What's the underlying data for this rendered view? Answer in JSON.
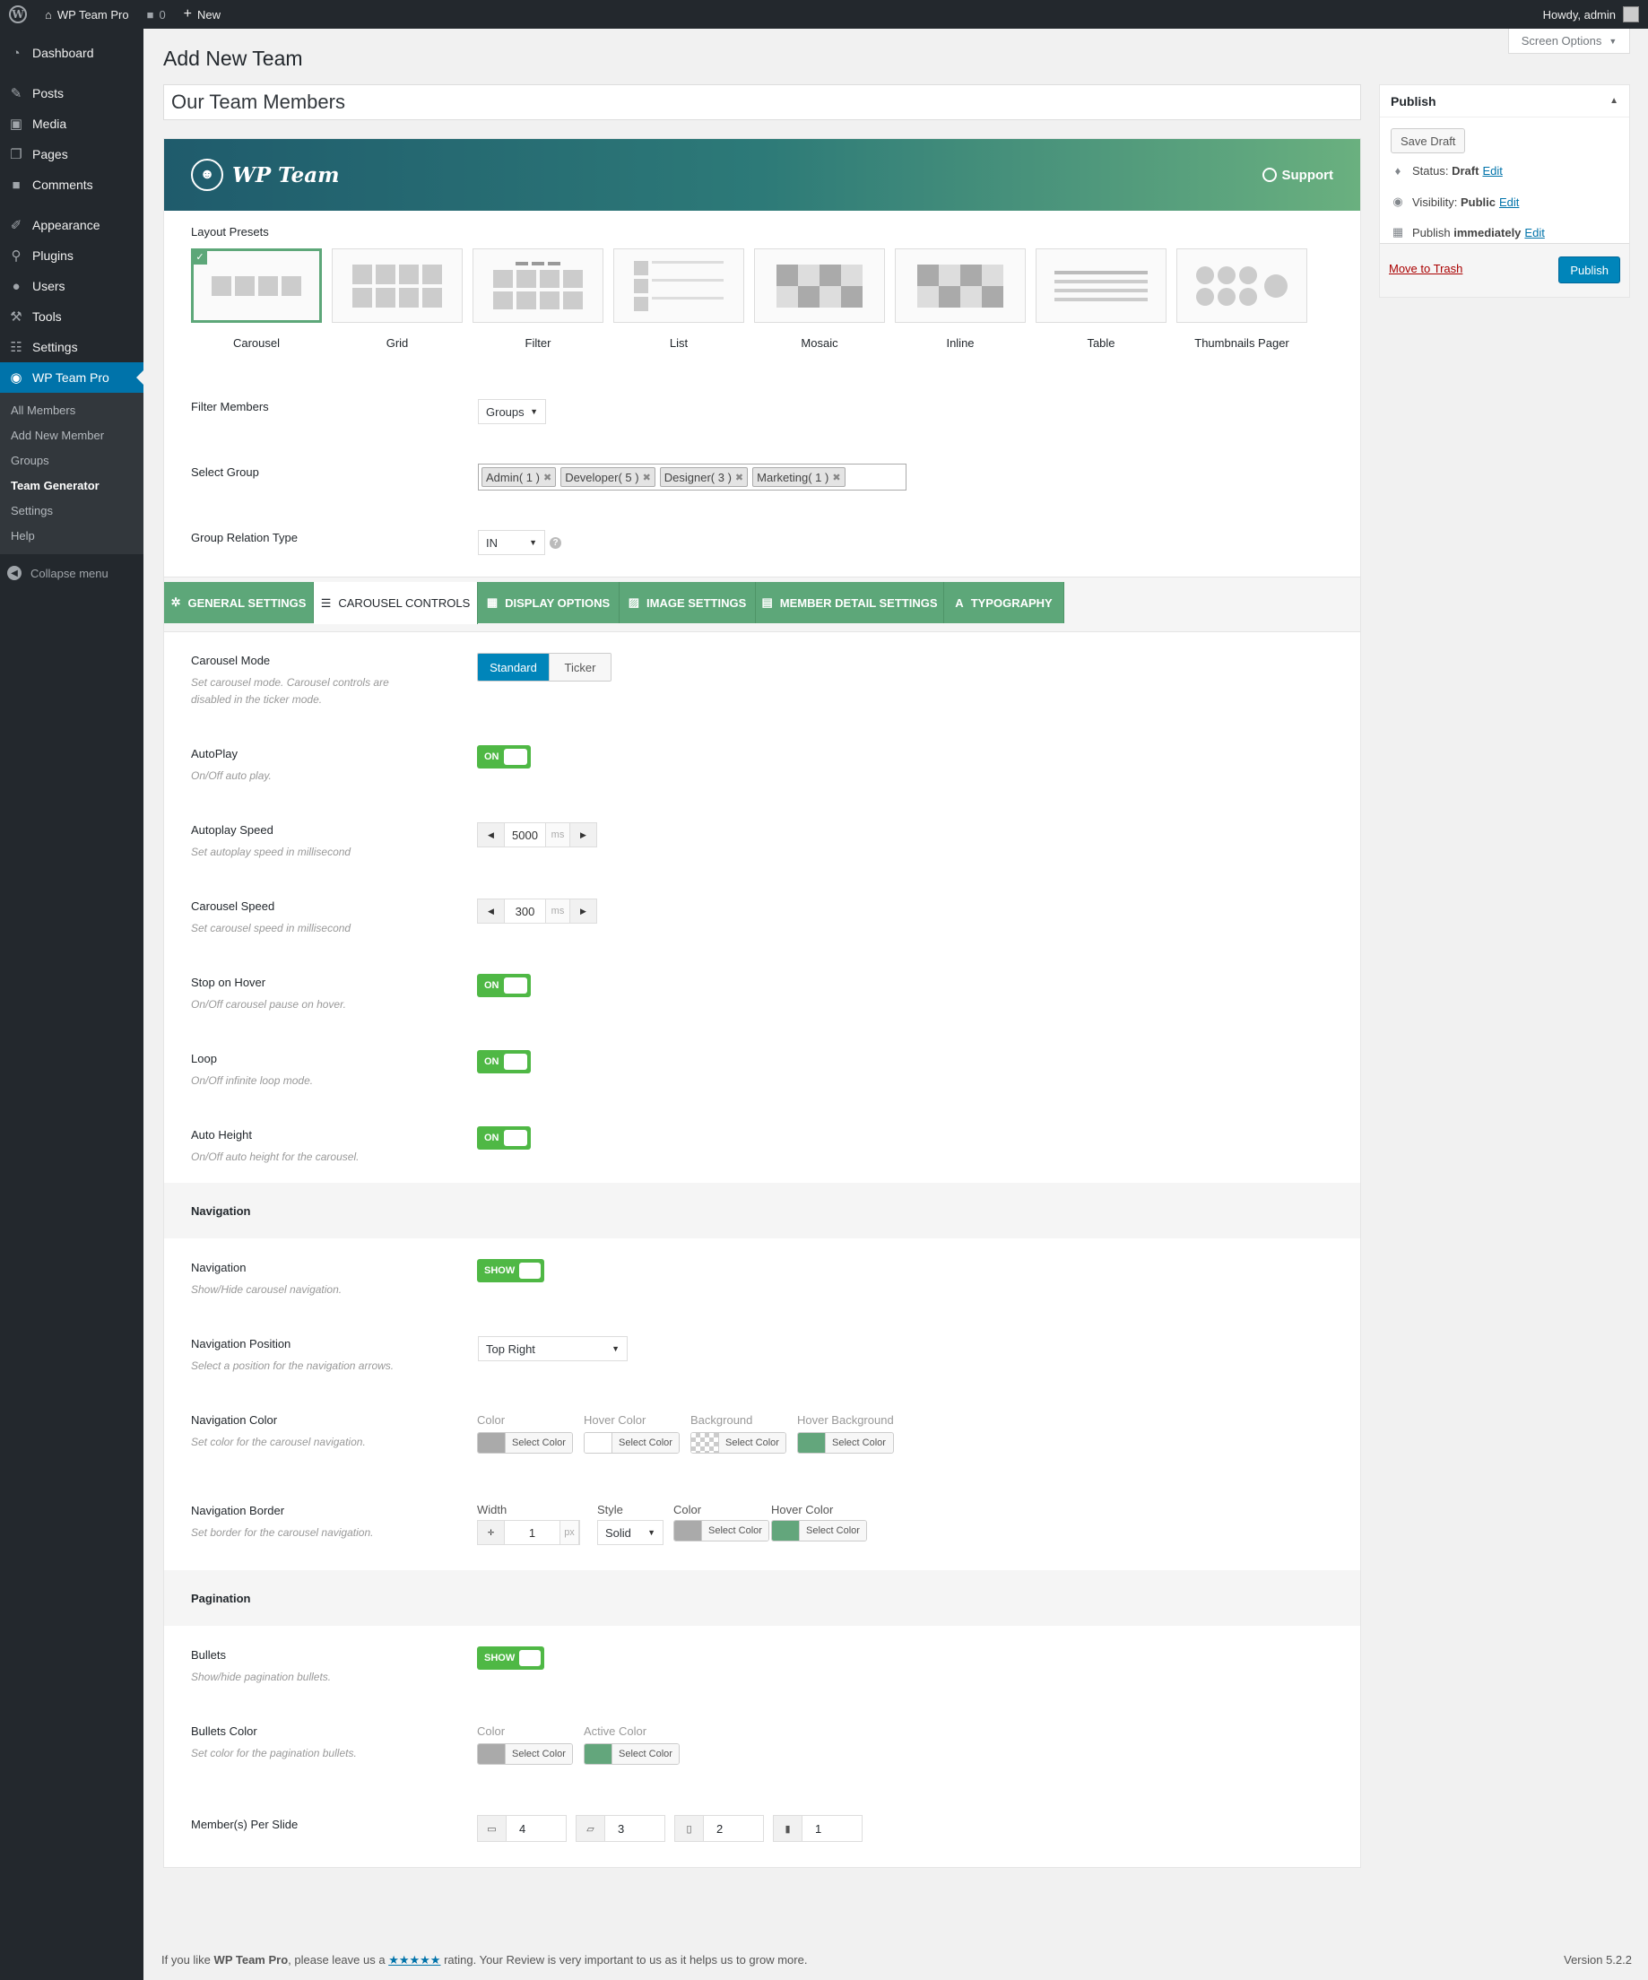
{
  "adminbar": {
    "site_name": "WP Team Pro",
    "comments_count": "0",
    "new_label": "New",
    "greeting": "Howdy, admin"
  },
  "sidebar": {
    "items": [
      {
        "label": "Dashboard",
        "icon": "dashboard-icon"
      },
      {
        "label": "Posts",
        "icon": "pin-icon"
      },
      {
        "label": "Media",
        "icon": "media-icon"
      },
      {
        "label": "Pages",
        "icon": "pages-icon"
      },
      {
        "label": "Comments",
        "icon": "comments-icon"
      },
      {
        "label": "Appearance",
        "icon": "brush-icon"
      },
      {
        "label": "Plugins",
        "icon": "plugin-icon"
      },
      {
        "label": "Users",
        "icon": "users-icon"
      },
      {
        "label": "Tools",
        "icon": "wrench-icon"
      },
      {
        "label": "Settings",
        "icon": "settings-icon"
      },
      {
        "label": "WP Team Pro",
        "icon": "team-icon"
      }
    ],
    "submenu": [
      "All Members",
      "Add New Member",
      "Groups",
      "Team Generator",
      "Settings",
      "Help"
    ],
    "collapse_label": "Collapse menu"
  },
  "screen_options": "Screen Options",
  "page_title": "Add New Team",
  "post_title": "Our Team Members",
  "banner": {
    "brand": "WP Team",
    "support": "Support"
  },
  "layout": {
    "label": "Layout Presets",
    "presets": [
      "Carousel",
      "Grid",
      "Filter",
      "List",
      "Mosaic",
      "Inline",
      "Table",
      "Thumbnails Pager"
    ],
    "selected": "Carousel"
  },
  "filter_members": {
    "label": "Filter Members",
    "value": "Groups"
  },
  "select_group": {
    "label": "Select Group",
    "tags": [
      "Admin( 1 )",
      "Developer( 5 )",
      "Designer( 3 )",
      "Marketing( 1 )"
    ]
  },
  "group_relation": {
    "label": "Group Relation Type",
    "value": "IN"
  },
  "tabs": [
    {
      "label": "GENERAL SETTINGS",
      "icon": "gear-icon"
    },
    {
      "label": "CAROUSEL CONTROLS",
      "icon": "sliders-icon"
    },
    {
      "label": "DISPLAY OPTIONS",
      "icon": "grid-icon"
    },
    {
      "label": "IMAGE SETTINGS",
      "icon": "image-icon"
    },
    {
      "label": "MEMBER DETAIL SETTINGS",
      "icon": "id-card-icon"
    },
    {
      "label": "TYPOGRAPHY",
      "icon": "font-icon"
    }
  ],
  "carousel": {
    "mode": {
      "label": "Carousel Mode",
      "desc": "Set carousel mode. Carousel controls are disabled in the ticker mode.",
      "options": [
        "Standard",
        "Ticker"
      ],
      "selected": "Standard"
    },
    "autoplay": {
      "label": "AutoPlay",
      "desc": "On/Off auto play.",
      "state": "ON"
    },
    "autoplay_speed": {
      "label": "Autoplay Speed",
      "desc": "Set autoplay speed in millisecond",
      "value": "5000",
      "unit": "ms"
    },
    "carousel_speed": {
      "label": "Carousel Speed",
      "desc": "Set carousel speed in millisecond",
      "value": "300",
      "unit": "ms"
    },
    "stop_hover": {
      "label": "Stop on Hover",
      "desc": "On/Off carousel pause on hover.",
      "state": "ON"
    },
    "loop": {
      "label": "Loop",
      "desc": "On/Off infinite loop mode.",
      "state": "ON"
    },
    "auto_height": {
      "label": "Auto Height",
      "desc": "On/Off auto height for the carousel.",
      "state": "ON"
    }
  },
  "navigation": {
    "heading": "Navigation",
    "nav": {
      "label": "Navigation",
      "desc": "Show/Hide carousel navigation.",
      "state": "SHOW"
    },
    "position": {
      "label": "Navigation Position",
      "desc": "Select a position for the navigation arrows.",
      "value": "Top Right"
    },
    "color": {
      "label": "Navigation Color",
      "desc": "Set color for the carousel navigation.",
      "pickers": [
        {
          "label": "Color",
          "button": "Select Color",
          "swatch": "#aaaaaa"
        },
        {
          "label": "Hover Color",
          "button": "Select Color",
          "swatch": "#ffffff"
        },
        {
          "label": "Background",
          "button": "Select Color",
          "swatch": "transparent"
        },
        {
          "label": "Hover Background",
          "button": "Select Color",
          "swatch": "#63a67c"
        }
      ]
    },
    "border": {
      "label": "Navigation Border",
      "desc": "Set border for the carousel navigation.",
      "width_label": "Width",
      "width_value": "1",
      "width_unit": "px",
      "style_label": "Style",
      "style_value": "Solid",
      "color_label": "Color",
      "color_button": "Select Color",
      "color_swatch": "#aaaaaa",
      "hover_label": "Hover Color",
      "hover_button": "Select Color",
      "hover_swatch": "#63a67c"
    }
  },
  "pagination": {
    "heading": "Pagination",
    "bullets": {
      "label": "Bullets",
      "desc": "Show/hide pagination bullets.",
      "state": "SHOW"
    },
    "bullets_color": {
      "label": "Bullets Color",
      "desc": "Set color for the pagination bullets.",
      "pickers": [
        {
          "label": "Color",
          "button": "Select Color",
          "swatch": "#aaaaaa"
        },
        {
          "label": "Active Color",
          "button": "Select Color",
          "swatch": "#63a67c"
        }
      ]
    },
    "per_slide": {
      "label": "Member(s) Per Slide",
      "values": [
        {
          "icon": "desktop-icon",
          "value": "4"
        },
        {
          "icon": "laptop-icon",
          "value": "3"
        },
        {
          "icon": "tablet-icon",
          "value": "2"
        },
        {
          "icon": "mobile-icon",
          "value": "1"
        }
      ]
    }
  },
  "publish": {
    "heading": "Publish",
    "save_draft": "Save Draft",
    "status_label": "Status:",
    "status_value": "Draft",
    "visibility_label": "Visibility:",
    "visibility_value": "Public",
    "publish_label": "Publish",
    "publish_value": "immediately",
    "edit": "Edit",
    "trash": "Move to Trash",
    "publish_button": "Publish"
  },
  "footer": {
    "text_before": "If you like",
    "plugin": "WP Team Pro",
    "text_mid": ", please leave us a",
    "stars": "★★★★★",
    "text_after": "rating. Your Review is very important to us as it helps us to grow more.",
    "version": "Version 5.2.2"
  },
  "colors": {
    "accent": "#5da779",
    "primary": "#0073aa",
    "toggle": "#4fb845"
  }
}
